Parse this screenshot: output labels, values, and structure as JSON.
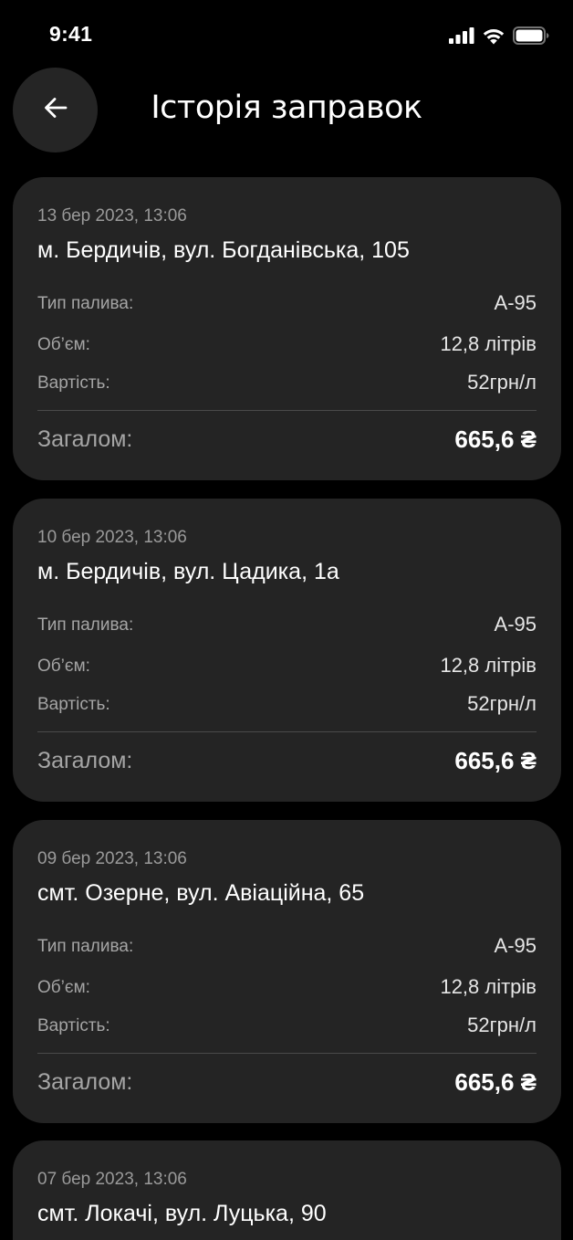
{
  "status_bar": {
    "time": "9:41",
    "icons": [
      "cellular-signal-icon",
      "wifi-icon",
      "battery-icon"
    ]
  },
  "header": {
    "back_icon": "arrow-left-icon",
    "title": "Історія заправок"
  },
  "labels": {
    "fuel_type": "Тип палива:",
    "volume": "Об’єм:",
    "price": "Вартість:",
    "total": "Загалом:"
  },
  "refuels": [
    {
      "date": "13 бер 2023, 13:06",
      "address": "м. Бердичів, вул. Богданівська, 105",
      "fuel_type": "А-95",
      "volume": "12,8 літрів",
      "price": "52грн/л",
      "total": "665,6 ₴"
    },
    {
      "date": "10 бер 2023, 13:06",
      "address": "м. Бердичів, вул. Цадика, 1а",
      "fuel_type": "А-95",
      "volume": "12,8 літрів",
      "price": "52грн/л",
      "total": "665,6 ₴"
    },
    {
      "date": "09 бер 2023, 13:06",
      "address": "смт. Озерне, вул. Авіаційна, 65",
      "fuel_type": "А-95",
      "volume": "12,8 літрів",
      "price": "52грн/л",
      "total": "665,6 ₴"
    },
    {
      "date": "07 бер 2023, 13:06",
      "address": "смт. Локачі, вул. Луцька, 90",
      "fuel_type": "",
      "volume": "",
      "price": "",
      "total": ""
    }
  ],
  "colors": {
    "background": "#000000",
    "card": "#242424",
    "back_button": "#252525",
    "muted_text": "#9a9a9a",
    "divider": "#4a4a4a"
  }
}
